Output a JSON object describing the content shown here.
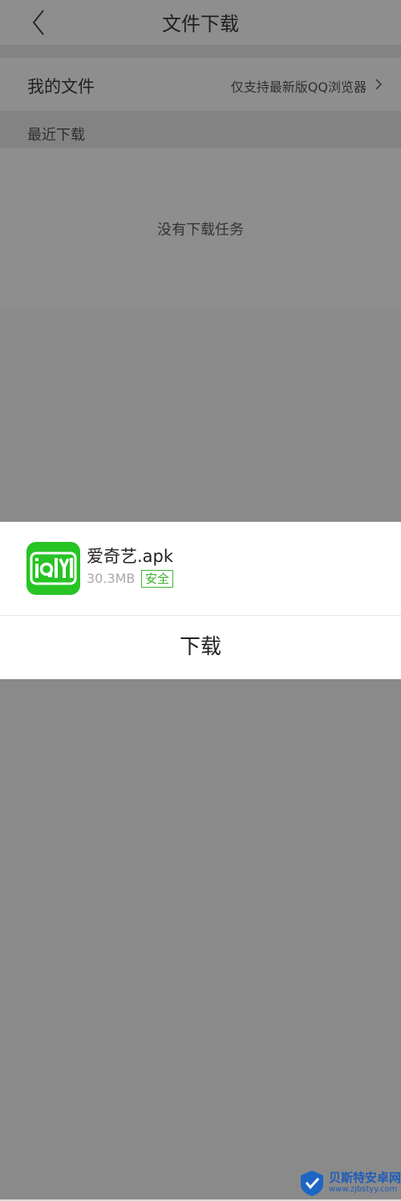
{
  "header": {
    "title": "文件下载"
  },
  "my_files": {
    "label": "我的文件",
    "hint": "仅支持最新版QQ浏览器"
  },
  "recent": {
    "label": "最近下载",
    "empty_text": "没有下载任务"
  },
  "sheet": {
    "app_name": "爱奇艺.apk",
    "app_size": "30.3MB",
    "safe_badge": "安全",
    "download_label": "下载",
    "icon_name": "iqiyi-logo",
    "icon_color": "#27c424"
  },
  "watermark": {
    "name": "贝斯特安卓网",
    "url": "www.zjbstyy.com"
  }
}
